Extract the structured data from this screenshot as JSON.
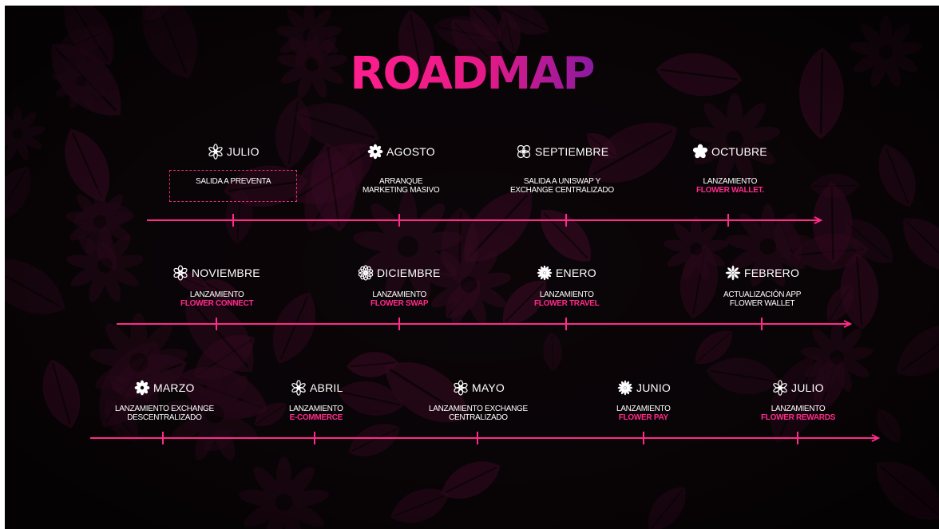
{
  "title": "ROADMAP",
  "colors": {
    "accent": "#ff2a8a",
    "background": "#0b0508",
    "text": "#ffffff"
  },
  "rows": [
    {
      "milestones": [
        {
          "month": "JULIO",
          "icon": "flower-outline-icon",
          "lines": [
            "SALIDA A PREVENTA"
          ],
          "highlight": ""
        },
        {
          "month": "AGOSTO",
          "icon": "flower-filled-icon",
          "lines": [
            "ARRANQUE",
            "MARKETING MASIVO"
          ],
          "highlight": ""
        },
        {
          "month": "SEPTIEMBRE",
          "icon": "flower-petals-icon",
          "lines": [
            "SALIDA A UNISWAP Y",
            "EXCHANGE CENTRALIZADO"
          ],
          "highlight": ""
        },
        {
          "month": "OCTUBRE",
          "icon": "flower-star-icon",
          "lines": [
            "LANZAMIENTO"
          ],
          "highlight": "FLOWER WALLET."
        }
      ]
    },
    {
      "milestones": [
        {
          "month": "NOVIEMBRE",
          "icon": "flower-ring-icon",
          "lines": [
            "LANZAMIENTO"
          ],
          "highlight": "FLOWER CONNECT"
        },
        {
          "month": "DICIEMBRE",
          "icon": "flower-mandala-icon",
          "lines": [
            "LANZAMIENTO"
          ],
          "highlight": "FLOWER SWAP"
        },
        {
          "month": "ENERO",
          "icon": "flower-burst-icon",
          "lines": [
            "LANZAMIENTO"
          ],
          "highlight": "FLOWER TRAVEL"
        },
        {
          "month": "FEBRERO",
          "icon": "flower-cross-icon",
          "lines": [
            "ACTUALIZACIÓN APP",
            "FLOWER WALLET"
          ],
          "highlight": ""
        }
      ]
    },
    {
      "milestones": [
        {
          "month": "MARZO",
          "icon": "flower-filled-icon",
          "lines": [
            "LANZAMIENTO EXCHANGE",
            "DESCENTRALIZADO"
          ],
          "highlight": ""
        },
        {
          "month": "ABRIL",
          "icon": "flower-outline-icon",
          "lines": [
            "LANZAMIENTO"
          ],
          "highlight": "E-COMMERCE"
        },
        {
          "month": "MAYO",
          "icon": "flower-ring-icon",
          "lines": [
            "LANZAMIENTO EXCHANGE",
            "CENTRALIZADO"
          ],
          "highlight": ""
        },
        {
          "month": "JUNIO",
          "icon": "flower-burst-icon",
          "lines": [
            "LANZAMIENTO"
          ],
          "highlight": "FLOWER PAY"
        },
        {
          "month": "JULIO",
          "icon": "flower-outline-icon",
          "lines": [
            "LANZAMIENTO"
          ],
          "highlight": "FLOWER REWARDS"
        }
      ]
    }
  ]
}
